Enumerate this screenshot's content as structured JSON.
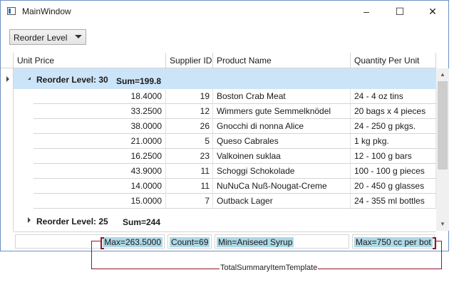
{
  "window": {
    "title": "MainWindow"
  },
  "controls": {
    "minimize": "–",
    "maximize": "☐",
    "close": "✕"
  },
  "combo": {
    "value": "Reorder Level"
  },
  "columns": [
    "Unit Price",
    "Supplier ID",
    "Product Name",
    "Quantity Per Unit"
  ],
  "groups": [
    {
      "label": "Reorder Level: 30",
      "sum": "Sum=199.8",
      "expanded": true
    },
    {
      "label": "Reorder Level: 25",
      "sum": "Sum=244",
      "expanded": false
    }
  ],
  "rows": [
    {
      "price": "18.4000",
      "supplier": "19",
      "name": "Boston Crab Meat",
      "qty": "24 - 4 oz tins"
    },
    {
      "price": "33.2500",
      "supplier": "12",
      "name": "Wimmers gute Semmelknödel",
      "qty": "20 bags x 4 pieces"
    },
    {
      "price": "38.0000",
      "supplier": "26",
      "name": "Gnocchi di nonna Alice",
      "qty": "24 - 250 g pkgs."
    },
    {
      "price": "21.0000",
      "supplier": "5",
      "name": "Queso Cabrales",
      "qty": "1 kg pkg."
    },
    {
      "price": "16.2500",
      "supplier": "23",
      "name": "Valkoinen suklaa",
      "qty": "12 - 100 g bars"
    },
    {
      "price": "43.9000",
      "supplier": "11",
      "name": "Schoggi Schokolade",
      "qty": "100 - 100 g pieces"
    },
    {
      "price": "14.0000",
      "supplier": "11",
      "name": "NuNuCa Nuß-Nougat-Creme",
      "qty": "20 - 450 g glasses"
    },
    {
      "price": "15.0000",
      "supplier": "7",
      "name": "Outback Lager",
      "qty": "24 - 355 ml bottles"
    }
  ],
  "totals": [
    "Max=263.5000",
    "Count=69",
    "Min=Aniseed Syrup",
    "Max=750 cc per bot"
  ],
  "annotation": "TotalSummaryItemTemplate",
  "colors": {
    "group_bg": "#cce4f7",
    "summary_bg": "#add8e6",
    "annotation": "#8b1a2b"
  }
}
